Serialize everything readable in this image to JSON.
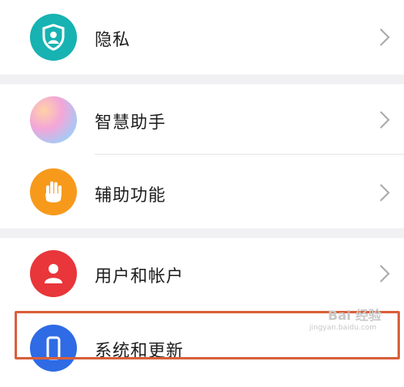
{
  "settings": {
    "items": [
      {
        "label": "隐私",
        "icon": "privacy-shield-icon",
        "color": "#17b2b2"
      },
      {
        "label": "智慧助手",
        "icon": "smart-assistant-icon",
        "color": "#e7a9d6"
      },
      {
        "label": "辅助功能",
        "icon": "hand-icon",
        "color": "#f79a1c"
      },
      {
        "label": "用户和帐户",
        "icon": "user-icon",
        "color": "#e8363a"
      },
      {
        "label": "系统和更新",
        "icon": "phone-icon",
        "color": "#2e6be5"
      }
    ]
  },
  "watermark": {
    "logo": "Bai 经验",
    "url": "jingyan.baidu.com"
  },
  "colors": {
    "highlight": "#d9603a",
    "section_gap": "#f1f1f3"
  }
}
